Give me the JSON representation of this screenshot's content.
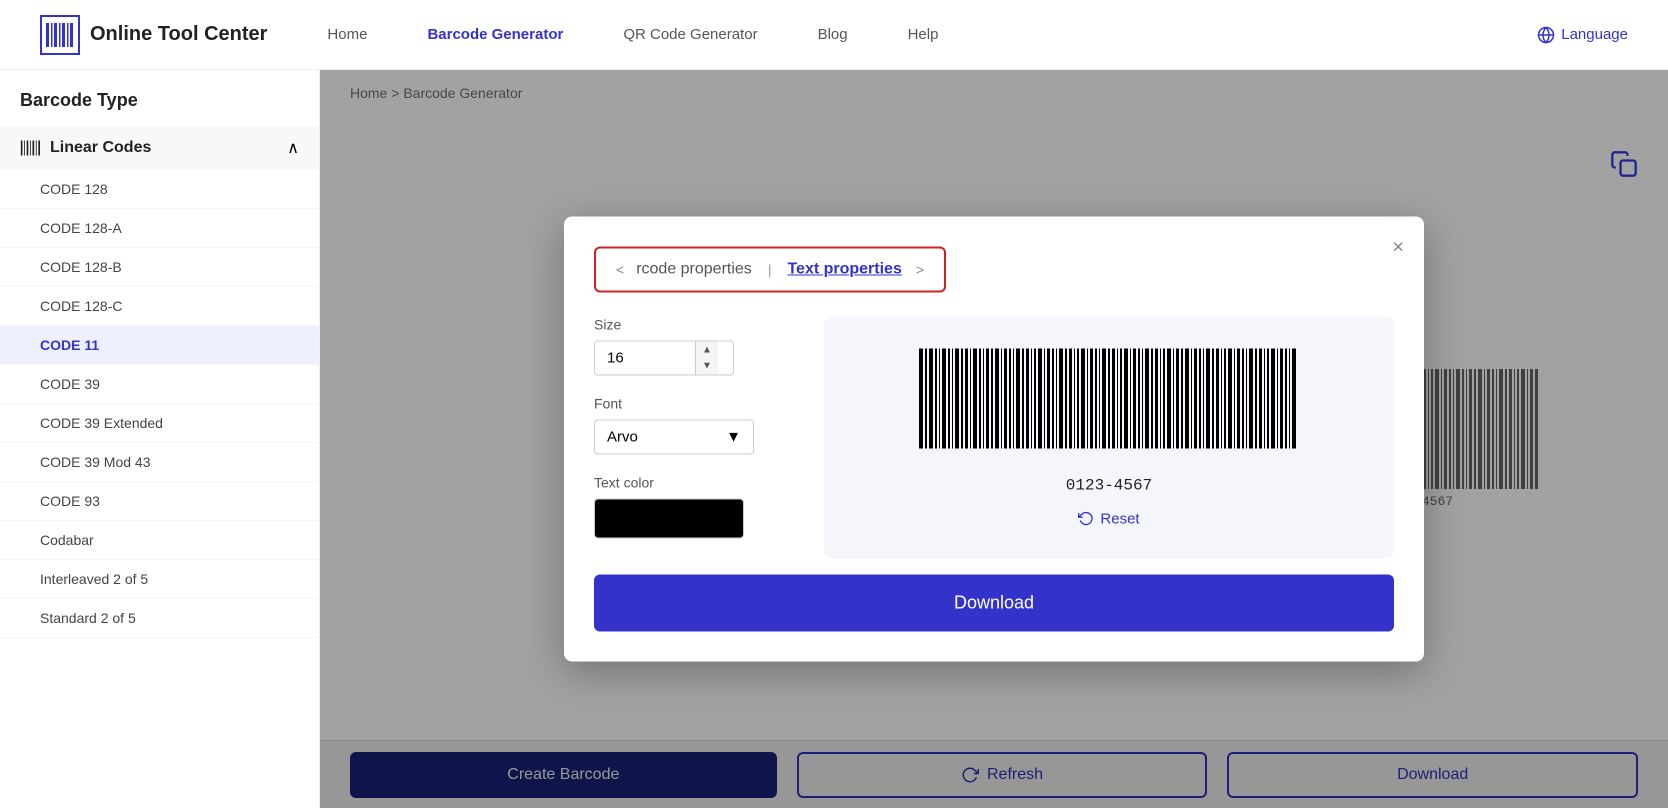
{
  "header": {
    "logo_text": "Online Tool Center",
    "nav_items": [
      {
        "label": "Home",
        "active": false
      },
      {
        "label": "Barcode Generator",
        "active": true
      },
      {
        "label": "QR Code Generator",
        "active": false
      },
      {
        "label": "Blog",
        "active": false
      },
      {
        "label": "Help",
        "active": false
      }
    ],
    "language_btn": "Language"
  },
  "sidebar": {
    "title": "Barcode Type",
    "section": {
      "label": "Linear Codes",
      "expanded": true
    },
    "items": [
      {
        "label": "CODE 128",
        "active": false
      },
      {
        "label": "CODE 128-A",
        "active": false
      },
      {
        "label": "CODE 128-B",
        "active": false
      },
      {
        "label": "CODE 128-C",
        "active": false
      },
      {
        "label": "CODE 11",
        "active": true
      },
      {
        "label": "CODE 39",
        "active": false
      },
      {
        "label": "CODE 39 Extended",
        "active": false
      },
      {
        "label": "CODE 39 Mod 43",
        "active": false
      },
      {
        "label": "CODE 93",
        "active": false
      },
      {
        "label": "Codabar",
        "active": false
      },
      {
        "label": "Interleaved 2 of 5",
        "active": false
      },
      {
        "label": "Standard 2 of 5",
        "active": false
      }
    ]
  },
  "breadcrumb": {
    "home": "Home",
    "separator": ">",
    "current": "Barcode Generator"
  },
  "bottom_bar": {
    "create_label": "Create Barcode",
    "refresh_label": "Refresh",
    "download_label": "Download"
  },
  "modal": {
    "tab_left": "rcode properties",
    "tab_right": "Text properties",
    "close_label": "×",
    "left_arrow": "<",
    "right_arrow": ">",
    "size_label": "Size",
    "size_value": "16",
    "font_label": "Font",
    "font_value": "Arvo",
    "text_color_label": "Text color",
    "barcode_value": "0123-4567",
    "reset_label": "Reset",
    "download_label": "Download"
  }
}
